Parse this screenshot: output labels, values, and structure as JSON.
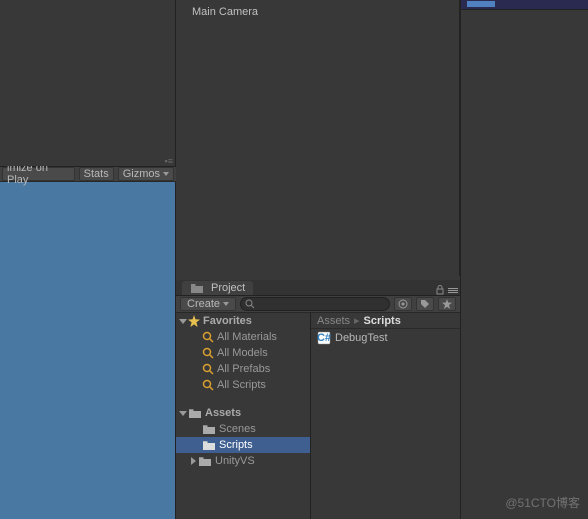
{
  "hierarchy": {
    "items": [
      "Main Camera"
    ]
  },
  "game_toolbar": {
    "maximize": "imize on Play",
    "stats": "Stats",
    "gizmos": "Gizmos"
  },
  "project": {
    "tab": "Project",
    "create": "Create",
    "favorites": {
      "header": "Favorites",
      "items": [
        "All Materials",
        "All Models",
        "All Prefabs",
        "All Scripts"
      ]
    },
    "assets": {
      "header": "Assets",
      "items": [
        {
          "label": "Scenes",
          "selected": false,
          "arrow": ""
        },
        {
          "label": "Scripts",
          "selected": true,
          "arrow": ""
        },
        {
          "label": "UnityVS",
          "selected": false,
          "arrow": "right"
        }
      ]
    },
    "breadcrumb": [
      {
        "label": "Assets",
        "active": false
      },
      {
        "label": "Scripts",
        "active": true
      }
    ],
    "files": [
      {
        "name": "DebugTest",
        "type": "cs"
      }
    ]
  },
  "watermark": "@51CTO博客"
}
